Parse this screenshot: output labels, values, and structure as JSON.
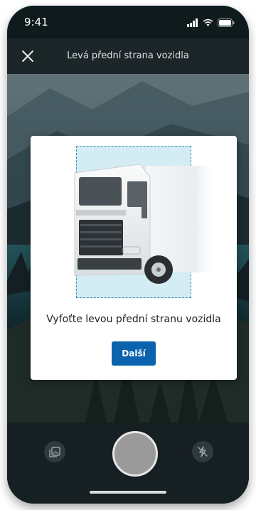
{
  "status_bar": {
    "time": "9:41"
  },
  "header": {
    "title": "Levá přední strana vozidla",
    "close_icon": "close-icon"
  },
  "modal": {
    "instruction": "Vyfoťte levou přední stranu vozidla",
    "next_label": "Další"
  },
  "controls": {
    "gallery_icon": "gallery-icon",
    "shutter_icon": "shutter-button",
    "flash_icon": "flash-off-icon"
  },
  "colors": {
    "primary": "#0b62ad",
    "frame_fill": "#d4ecf4",
    "frame_border": "#3a8fb2"
  }
}
